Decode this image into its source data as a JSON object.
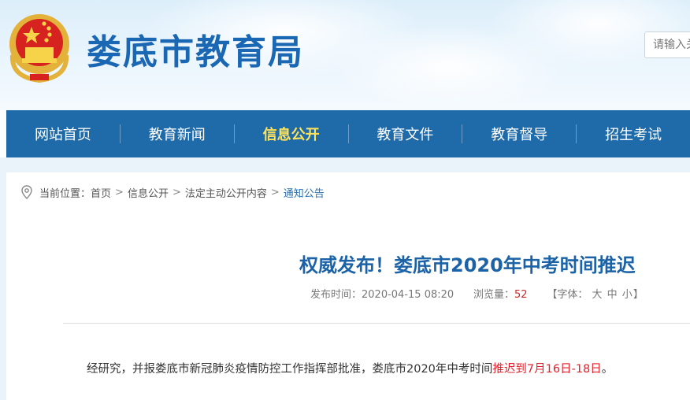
{
  "header": {
    "site_title": "娄底市教育局",
    "search_placeholder": "请输入关键字"
  },
  "nav": {
    "items": [
      {
        "label": "网站首页",
        "active": false
      },
      {
        "label": "教育新闻",
        "active": false
      },
      {
        "label": "信息公开",
        "active": true
      },
      {
        "label": "教育文件",
        "active": false
      },
      {
        "label": "教育督导",
        "active": false
      },
      {
        "label": "招生考试",
        "active": false
      }
    ]
  },
  "breadcrumb": {
    "prefix": "当前位置：",
    "items": [
      "首页",
      "信息公开",
      "法定主动公开内容",
      "通知公告"
    ]
  },
  "article": {
    "title": "权威发布！娄底市2020年中考时间推迟",
    "published_label": "发布时间：",
    "published": "2020-04-15 08:20",
    "views_label": "浏览量：",
    "views": "52",
    "font_size_prefix": "【字体：",
    "font_sizes": [
      "大",
      "中",
      "小"
    ],
    "font_size_suffix": "】",
    "body_before": "经研究，并报娄底市新冠肺炎疫情防控工作指挥部批准，娄底市2020年中考时间",
    "body_highlight": "推迟到7月16日-18日",
    "body_after": "。"
  },
  "colors": {
    "brand_blue": "#1f6aa9",
    "title_blue": "#1b62a6",
    "active_nav": "#ffe35a",
    "highlight_red": "#e0202a"
  }
}
